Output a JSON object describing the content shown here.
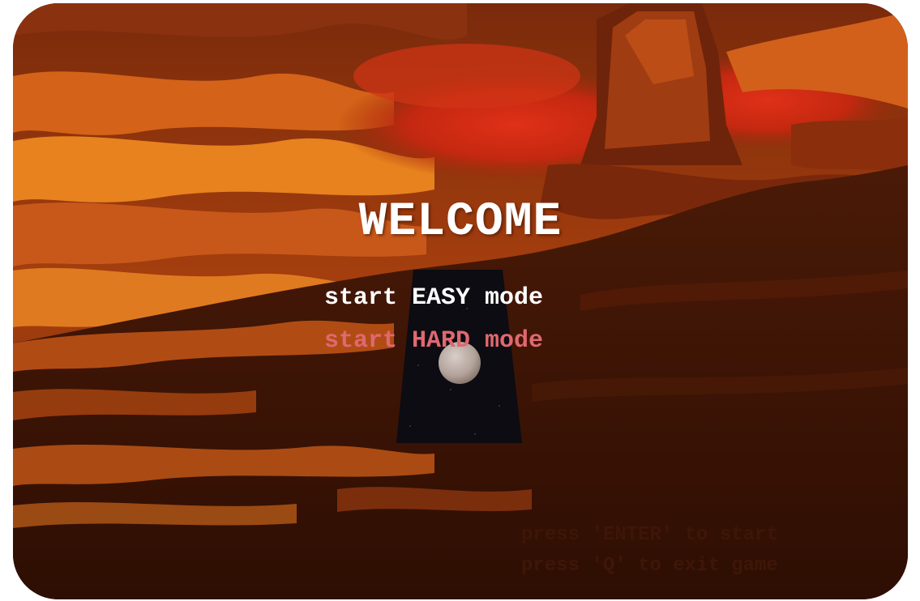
{
  "title": "WELCOME",
  "menu": {
    "items": [
      {
        "label": "start EASY mode",
        "state": "normal"
      },
      {
        "label": "start HARD mode",
        "state": "selected"
      }
    ]
  },
  "hints": [
    "press 'ENTER' to start",
    "press 'Q' to exit game"
  ],
  "colors": {
    "menu_normal": "#ffffff",
    "menu_selected": "#e06870",
    "hint_text": "#3e1608",
    "track": "#0c0c12",
    "ball": "#b8aaa4"
  }
}
